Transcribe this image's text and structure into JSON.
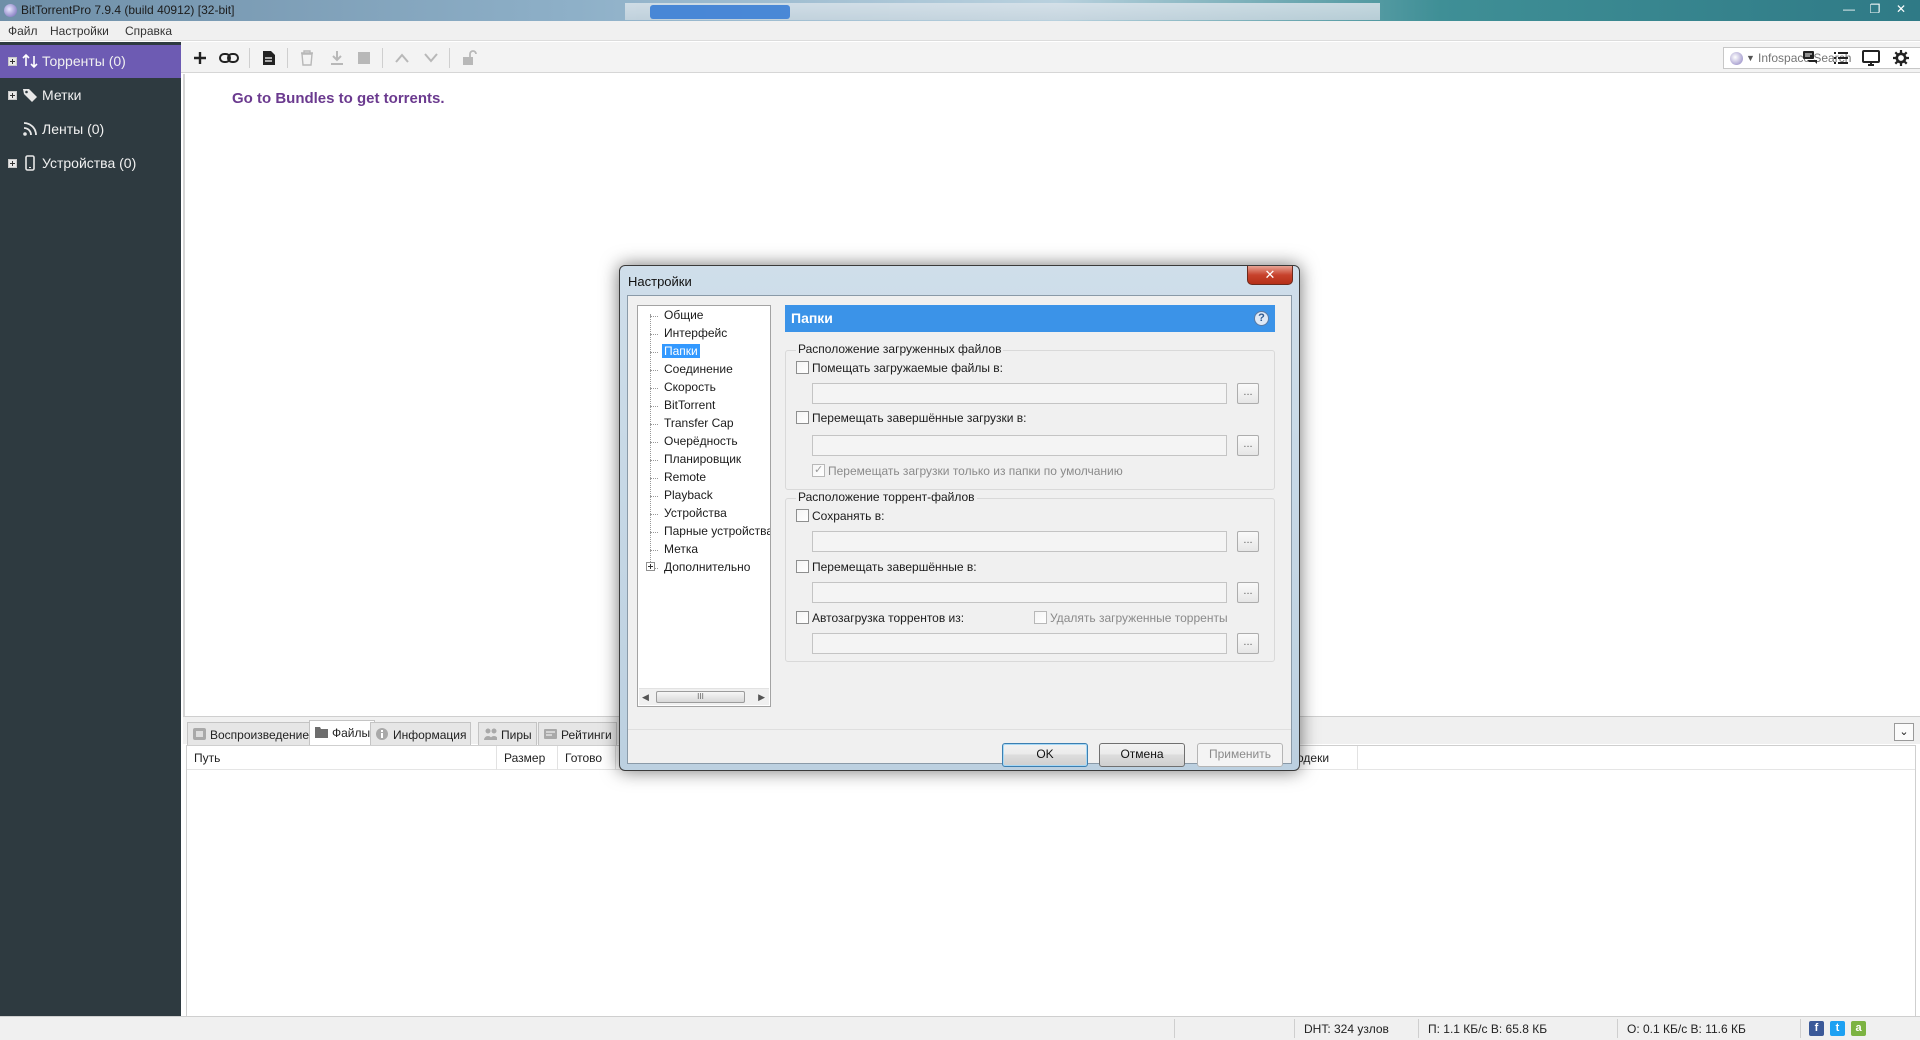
{
  "window": {
    "title": "BitTorrentPro 7.9.4  (build 40912) [32-bit]",
    "controls": [
      "—",
      "❐",
      "✕"
    ]
  },
  "menu": [
    "Файл",
    "Настройки",
    "Справка"
  ],
  "sidebar": {
    "items": [
      {
        "label": "Торренты (0)",
        "icon": "transfer-arrows-icon",
        "active": true
      },
      {
        "label": "Метки",
        "icon": "tag-icon"
      },
      {
        "label": "Ленты (0)",
        "icon": "rss-feed-icon"
      },
      {
        "label": "Устройства (0)",
        "icon": "mobile-device-icon"
      }
    ]
  },
  "toolbar": {
    "search_placeholder": "Infospace Search",
    "buttons": [
      "add-torrent",
      "add-from-url",
      "create-torrent",
      "delete",
      "start",
      "stop",
      "move-up",
      "move-down",
      "unlock",
      "chat",
      "list-view",
      "remote",
      "settings"
    ]
  },
  "main": {
    "bundles_text": "Go to Bundles to get torrents."
  },
  "bottom_tabs": [
    {
      "label": "Воспроизведение",
      "icon": "playback-icon"
    },
    {
      "label": "Файлы",
      "icon": "files-icon",
      "active": true
    },
    {
      "label": "Информация",
      "icon": "info-icon"
    },
    {
      "label": "Пиры",
      "icon": "peers-icon"
    },
    {
      "label": "Рейтинги",
      "icon": "ratings-icon"
    }
  ],
  "file_columns": {
    "path": "Путь",
    "size": "Размер",
    "done": "Готово",
    "codecs": "одеки"
  },
  "status": {
    "dht": "DHT: 324 узлов",
    "download": "П: 1.1 КБ/с В: 65.8 КБ",
    "upload": "О: 0.1 КБ/с В: 11.6 КБ",
    "colors": {
      "facebook": "#3b5998",
      "twitter": "#1da1f2",
      "android": "#7cb342"
    }
  },
  "dialog": {
    "title": "Настройки",
    "close": "✕",
    "tree": [
      "Общие",
      "Интерфейс",
      "Папки",
      "Соединение",
      "Скорость",
      "BitTorrent",
      "Transfer Cap",
      "Очерёдность",
      "Планировщик",
      "Remote",
      "Playback",
      "Устройства",
      "Парные устройства",
      "Метка",
      "Дополнительно"
    ],
    "selected": "Папки",
    "tree_scroll_thumb": "III",
    "panel_title": "Папки",
    "help": "?",
    "downloaded_group": "Расположение загруженных файлов",
    "put_downloads_in": "Помещать загружаемые файлы в:",
    "move_completed_to": "Перемещать завершённые загрузки в:",
    "only_from_default": "Перемещать загрузки только из папки по умолчанию",
    "torrent_group": "Расположение торрент-файлов",
    "store_in": "Сохранять в:",
    "move_completed_torrents": "Перемещать завершённые в:",
    "autoload_from": "Автозагрузка торрентов из:",
    "delete_loaded": "Удалять загруженные торренты",
    "browse": "...",
    "ok": "OK",
    "cancel": "Отмена",
    "apply": "Применить"
  }
}
